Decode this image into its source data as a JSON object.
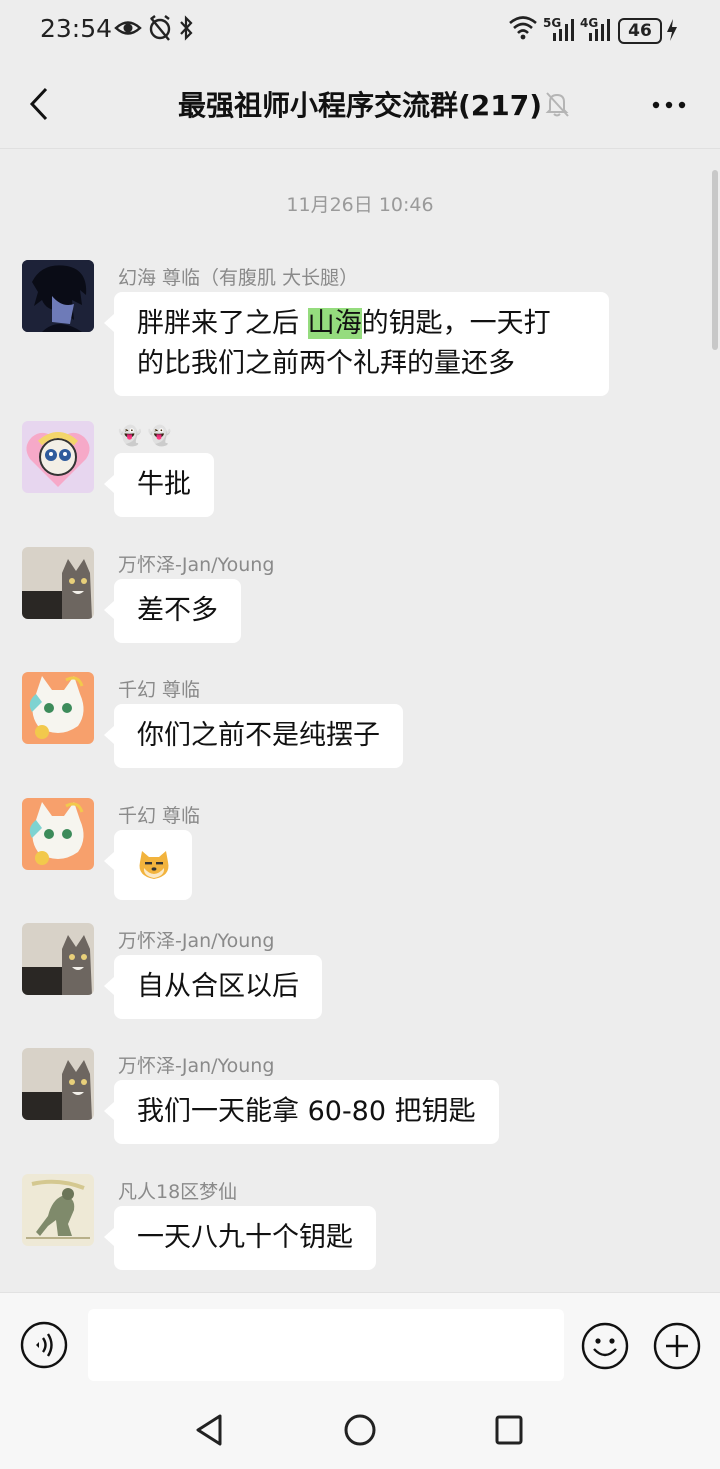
{
  "status": {
    "time": "23:54",
    "net1": "5G",
    "net2": "4G",
    "battery": "46"
  },
  "nav": {
    "title": "最强祖师小程序交流群(217)"
  },
  "chat": {
    "time_divider": "11月26日 10:46",
    "messages": [
      {
        "sender": "幻海 尊临（有腹肌 大长腿）",
        "line1_before": "胖胖来了之后 ",
        "highlight": "山海",
        "line1_after": "的钥匙，一天打",
        "line2": "的比我们之前两个礼拜的量还多"
      },
      {
        "sender": "👻 👻",
        "text": "牛批"
      },
      {
        "sender": "万怀泽-Jan/Young",
        "text": "差不多"
      },
      {
        "sender": "千幻 尊临",
        "text": "你们之前不是纯摆子"
      },
      {
        "sender": "千幻 尊临",
        "sticker": "doge-emoji"
      },
      {
        "sender": "万怀泽-Jan/Young",
        "text": "自从合区以后"
      },
      {
        "sender": "万怀泽-Jan/Young",
        "text": "我们一天能拿 60-80 把钥匙"
      },
      {
        "sender": "凡人18区梦仙",
        "text": "一天八九十个钥匙"
      }
    ]
  },
  "input": {
    "placeholder": ""
  },
  "colors": {
    "background": "#ededed",
    "bubble": "#ffffff",
    "highlight": "#95dc7e",
    "sender_text": "#8a8a8a"
  }
}
